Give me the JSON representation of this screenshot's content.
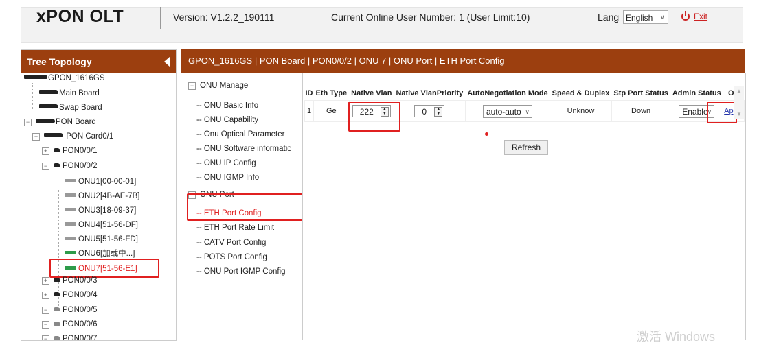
{
  "header": {
    "logo": "xPON OLT",
    "version": "Version: V1.2.2_190111",
    "online_users": "Current Online User Number: 1 (User Limit:10)",
    "lang_label": "Lang",
    "lang_value": "English",
    "exit_label": "Exit"
  },
  "tree": {
    "title": "Tree Topology",
    "root": "GPON_1616GS",
    "main_board": "Main Board",
    "swap_board": "Swap Board",
    "pon_board": "PON Board",
    "pon_card": "PON Card0/1",
    "pons": [
      "PON0/0/1",
      "PON0/0/2",
      "PON0/0/3",
      "PON0/0/4",
      "PON0/0/5",
      "PON0/0/6",
      "PON0/0/7"
    ],
    "onus": [
      "ONU1[00-00-01]",
      "ONU2[4B-AE-7B]",
      "ONU3[18-09-37]",
      "ONU4[51-56-DF]",
      "ONU5[51-56-FD]",
      "ONU6[加载中...]",
      "ONU7[51-56-E1]"
    ]
  },
  "breadcrumb": "GPON_1616GS | PON Board | PON0/0/2 | ONU 7 | ONU Port | ETH Port Config",
  "menu": {
    "onu_manage": "ONU Manage",
    "manage_items": [
      "ONU Basic Info",
      "ONU Capability",
      "Onu Optical Parameter",
      "ONU Software informatic",
      "ONU IP Config",
      "ONU IGMP Info"
    ],
    "onu_port": "ONU Port",
    "port_items": [
      "ETH Port Config",
      "ETH Port Rate Limit",
      "CATV Port Config",
      "POTS Port Config",
      "ONU Port IGMP Config"
    ]
  },
  "eth_table": {
    "columns": [
      "ID",
      "Eth Type",
      "Native Vlan",
      "Native VlanPriority",
      "AutoNegotiation Mode",
      "Speed & Duplex",
      "Stp Port Status",
      "Admin Status",
      "OP"
    ],
    "row": {
      "id": "1",
      "eth_type": "Ge",
      "native_vlan": "222",
      "native_vlan_priority": "0",
      "autoneg": "auto-auto",
      "speed_duplex": "Unknow",
      "stp_status": "Down",
      "admin_status": "Enable",
      "op": "Apply"
    },
    "refresh_label": "Refresh"
  },
  "watermark": "激活 Windows",
  "colors": {
    "header_bg": "#9c3f0f",
    "highlight": "#e02020",
    "link": "#2233aa"
  }
}
